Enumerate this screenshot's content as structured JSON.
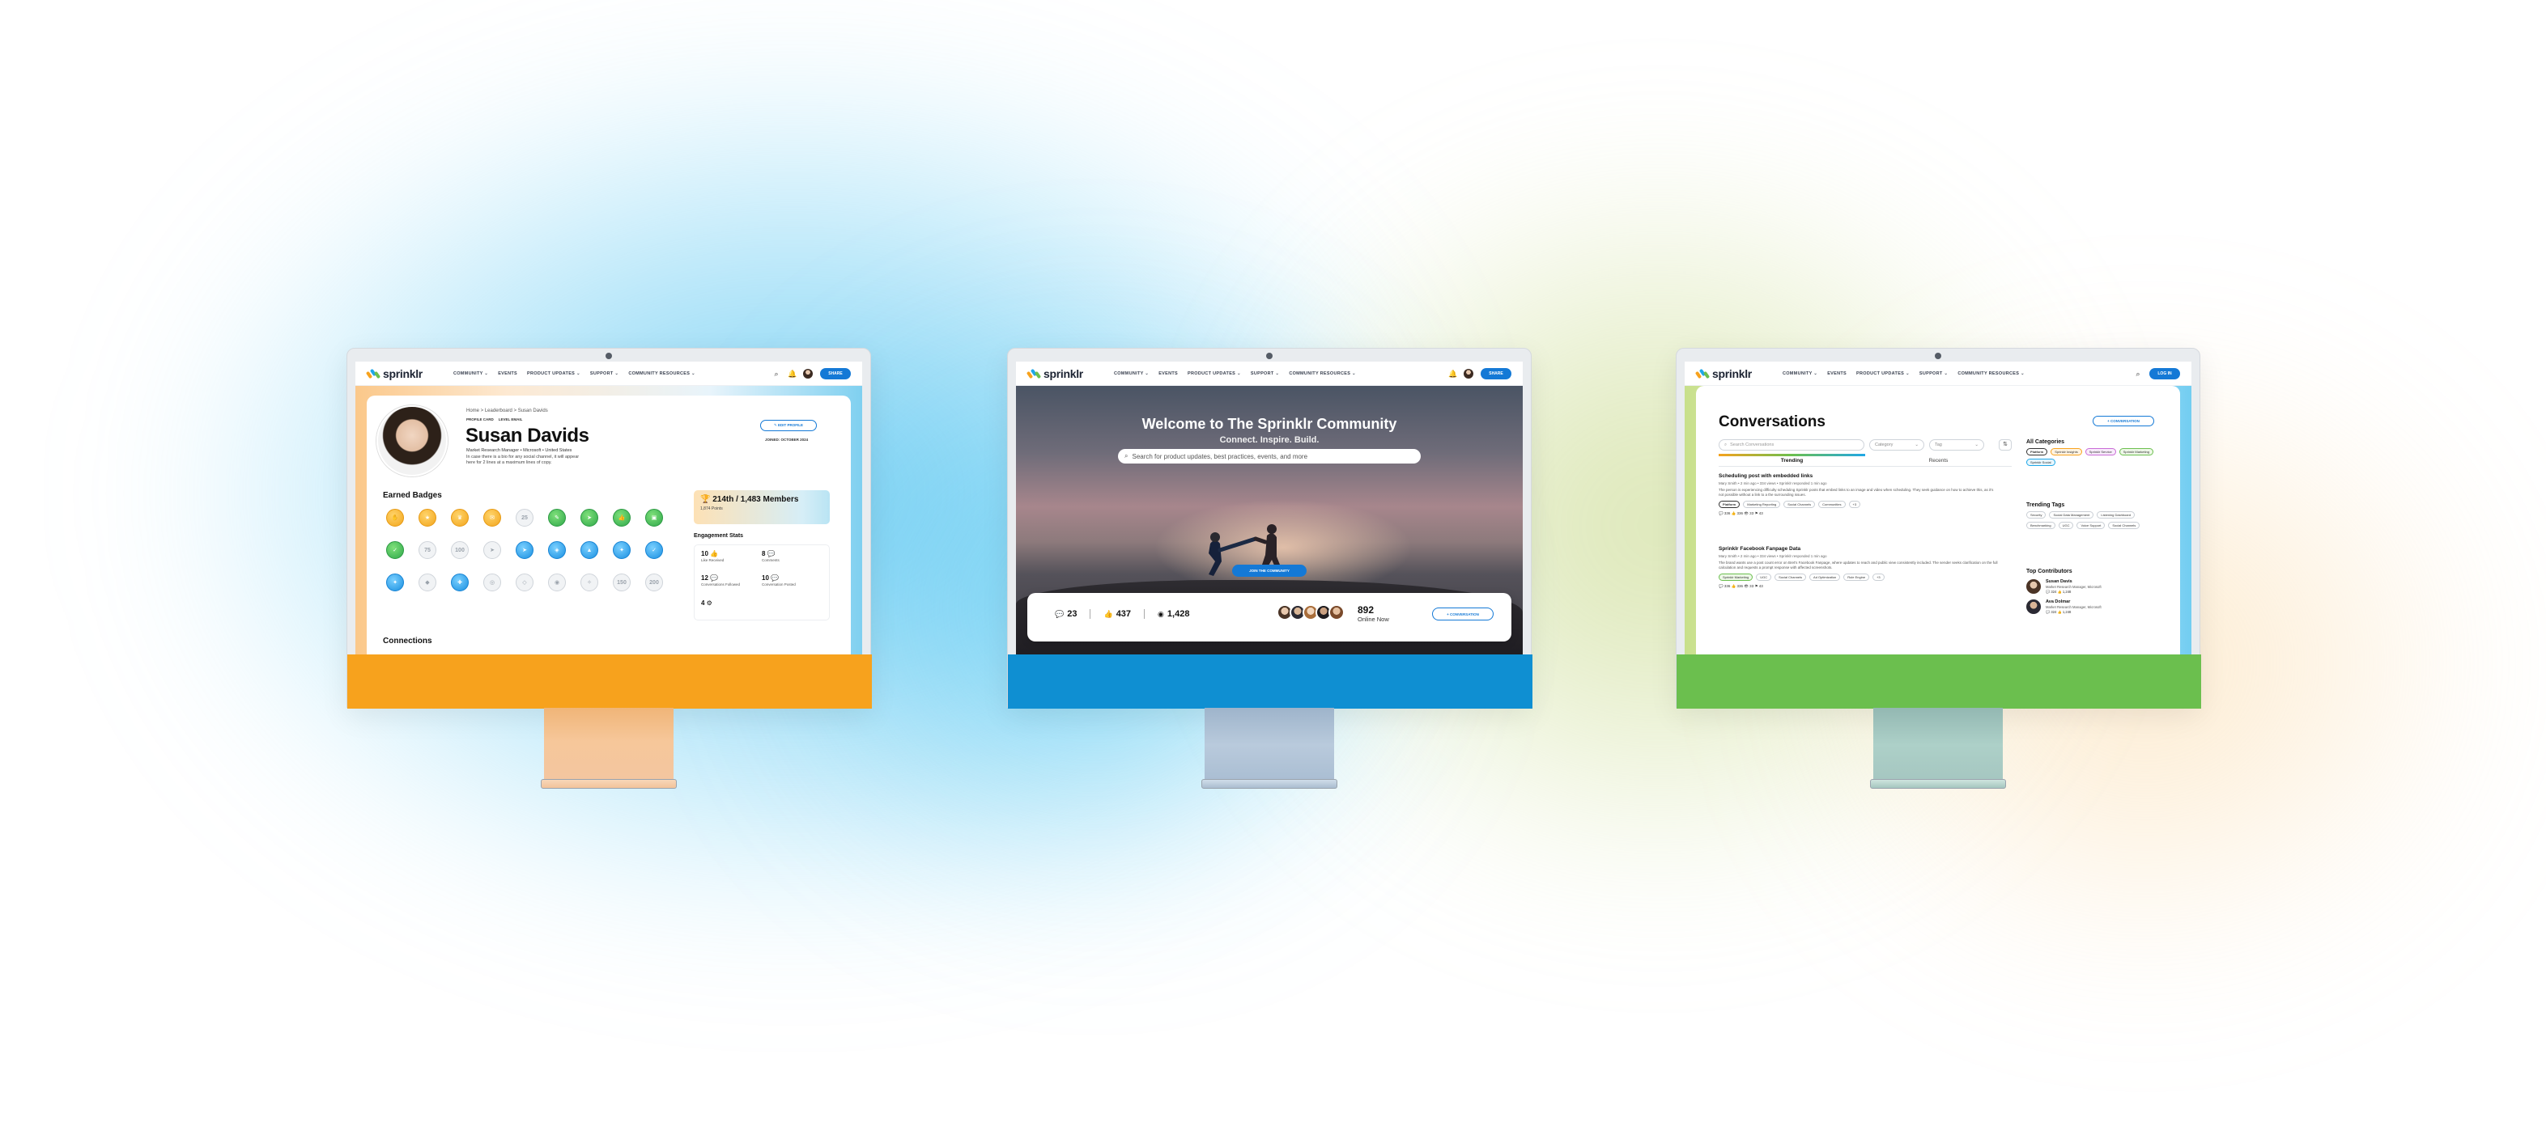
{
  "nav": {
    "brand": "sprinklr",
    "links": [
      "COMMUNITY ⌄",
      "EVENTS",
      "PRODUCT UPDATES ⌄",
      "SUPPORT ⌄",
      "COMMUNITY RESOURCES ⌄"
    ],
    "brand_colors": [
      "#f7a21d",
      "#1fa7e8",
      "#6bbf4e"
    ]
  },
  "profile": {
    "nav_button": "SHARE",
    "breadcrumb": "Home > Leaderboard > Susan Davids",
    "tag1": "PROFILE CARD",
    "tag2": "LEVEL EMAIL",
    "name": "Susan Davids",
    "role": "Market Research Manager • Microsoft • United States",
    "bio": "In case there is a bio for any social channel, it will appear here for 2 lines at a maximum lines of copy.",
    "edit_button": "✎ EDIT PROFILE",
    "joined": "JOINED: OCTOBER 2024",
    "badges_heading": "Earned Badges",
    "rank": "🏆 214th / 1,483 Members",
    "points": "1,874 Points",
    "engagement_heading": "Engagement Stats",
    "stats": [
      {
        "value": "10 👍",
        "label": "Like Received"
      },
      {
        "value": "8 💬",
        "label": "Comments"
      },
      {
        "value": "12 💬",
        "label": "Conversations Followed"
      },
      {
        "value": "10 💬",
        "label": "Conversation Posted"
      },
      {
        "value": "4 ⚙",
        "label": ""
      }
    ],
    "connections_heading": "Connections",
    "badge_glyphs": [
      "25",
      "75",
      "100",
      "150",
      "200"
    ]
  },
  "home": {
    "nav_button": "SHARE",
    "title": "Welcome to The Sprinklr Community",
    "subtitle": "Connect. Inspire. Build.",
    "search_placeholder": "Search for product updates, best practices, events, and more",
    "join_button": "JOIN THE COMMUNITY",
    "stats": [
      "23",
      "437",
      "1,428"
    ],
    "online_count": "892",
    "online_label": "Online Now",
    "conversation_button": "+ CONVERSATION"
  },
  "conversations": {
    "nav_button": "LOG IN",
    "title": "Conversations",
    "new_button": "+ CONVERSATION",
    "search_placeholder": "Search Conversations",
    "category_placeholder": "Category",
    "tag_placeholder": "Tag",
    "tabs": [
      "Trending",
      "Recents"
    ],
    "posts": [
      {
        "title": "Scheduling post with embedded links",
        "meta": "Mary Smith • 2 min ago • 334 views • Sprinklr responded 1 min ago",
        "body": "The person is experiencing difficulty scheduling Sprinklr posts that embed links to an image and video when scheduling. They seek guidance on how to achieve this, as it's not possible without a link to a the surrounding issues.",
        "chips": [
          "Platform",
          "Marketing Reporting",
          "Social Channels",
          "Communities",
          "+3"
        ],
        "stats": "💬 336   👍 336   👁 33   ⚑ 43"
      },
      {
        "title": "Sprinklr Facebook Fanpage Data",
        "meta": "Mary Smith • 2 min ago • 334 views • Sprinklr responded 1 min ago",
        "body": "The brand wants use a post count error on Bret's Facebook Fanpage, where updates to reach and public view consistently included. The sender seeks clarification on the full calculation and requests a prompt response with affected screenshots.",
        "chips": [
          "Sprinklr Marketing",
          "UGC",
          "Social Channels",
          "Ad Optimization",
          "Rule Engine",
          "+3"
        ],
        "stats": "💬 336   👍 336   👁 33   ⚑ 43"
      }
    ],
    "all_categories": "All Categories",
    "categories": [
      "Platform",
      "Sprinklr Insights",
      "Sprinklr Service",
      "Sprinklr Marketing",
      "Sprinklr Social"
    ],
    "trending_tags_heading": "Trending Tags",
    "tags": [
      "Security",
      "Social Data Management",
      "Listening Dashboard",
      "Benchmarking",
      "UGC",
      "Voice Support",
      "Social Channels"
    ],
    "top_contributors_heading": "Top Contributors",
    "contributors": [
      {
        "name": "Susan Davis",
        "role": "Market Research Manager, Microsoft",
        "stats": "💬 324  👍 1,248"
      },
      {
        "name": "Ava Dolmar",
        "role": "Market Research Manager, Microsoft",
        "stats": "💬 324  👍 1,248"
      }
    ]
  }
}
